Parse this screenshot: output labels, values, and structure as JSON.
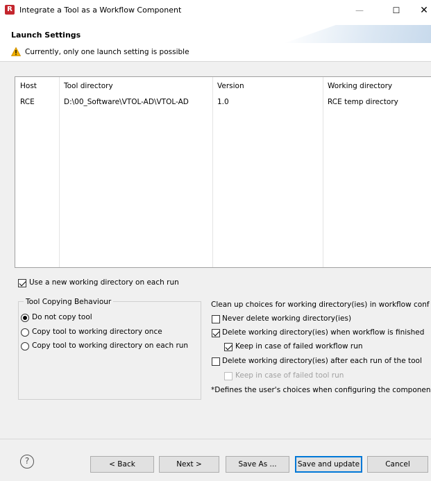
{
  "window": {
    "title": "Integrate a Tool as a Workflow Component",
    "app_icon_letter": "R",
    "minimize": "—",
    "maximize": "☐",
    "close": "✕"
  },
  "header": {
    "title": "Launch Settings",
    "message": "Currently, only one launch setting is possible",
    "warning_color": "#f2b100"
  },
  "table": {
    "columns": [
      "Host",
      "Tool directory",
      "Version",
      "Working directory"
    ],
    "rows": [
      [
        "RCE",
        "D:\\00_Software\\VTOL-AD\\VTOL-AD",
        "1.0",
        "RCE temp directory"
      ]
    ]
  },
  "options": {
    "new_working_dir": {
      "label": "Use a new working directory on each run",
      "checked": true
    }
  },
  "tool_copying": {
    "title": "Tool Copying Behaviour",
    "options": [
      {
        "label": "Do not copy tool",
        "selected": true
      },
      {
        "label": "Copy tool to working directory once",
        "selected": false
      },
      {
        "label": "Copy tool to working directory on each run",
        "selected": false
      }
    ]
  },
  "cleanup": {
    "title": "Clean up choices for working directory(ies) in workflow conf",
    "items": [
      {
        "label": "Never delete working directory(ies)",
        "checked": false,
        "enabled": true
      },
      {
        "label": "Delete working directory(ies) when workflow is finished",
        "checked": true,
        "enabled": true
      },
      {
        "label": "Keep in case of failed workflow run",
        "checked": true,
        "enabled": true
      },
      {
        "label": "Delete working directory(ies) after each run of the tool",
        "checked": false,
        "enabled": true
      },
      {
        "label": "Keep in case of failed tool run",
        "checked": false,
        "enabled": false
      }
    ],
    "note": "*Defines the user's choices when configuring the componen"
  },
  "buttons": {
    "help": "?",
    "back": "< Back",
    "next": "Next >",
    "save_as": "Save As ...",
    "save_update": "Save and update",
    "cancel": "Cancel"
  }
}
